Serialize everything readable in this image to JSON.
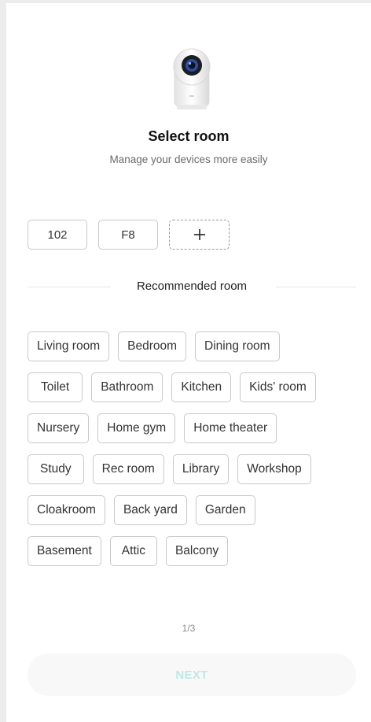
{
  "header": {
    "title": "Select room",
    "subtitle": "Manage your devices more easily"
  },
  "existing_rooms": [
    {
      "label": "102"
    },
    {
      "label": "F8"
    }
  ],
  "add_room": {
    "icon": "plus-icon"
  },
  "recommended": {
    "label": "Recommended room",
    "rows": [
      [
        "Living room",
        "Bedroom",
        "Dining room"
      ],
      [
        "Toilet",
        "Bathroom",
        "Kitchen",
        "Kids' room"
      ],
      [
        "Nursery",
        "Home gym",
        "Home theater"
      ],
      [
        "Study",
        "Rec room",
        "Library",
        "Workshop"
      ],
      [
        "Cloakroom",
        "Back yard",
        "Garden"
      ],
      [
        "Basement",
        "Attic",
        "Balcony"
      ]
    ]
  },
  "pager": {
    "text": "1/3"
  },
  "next_button": {
    "label": "NEXT",
    "text_color": "#bfe7e4"
  },
  "colors": {
    "chip_border": "#c9c9c9",
    "title": "#111111",
    "subtitle": "#6b6b6b"
  }
}
